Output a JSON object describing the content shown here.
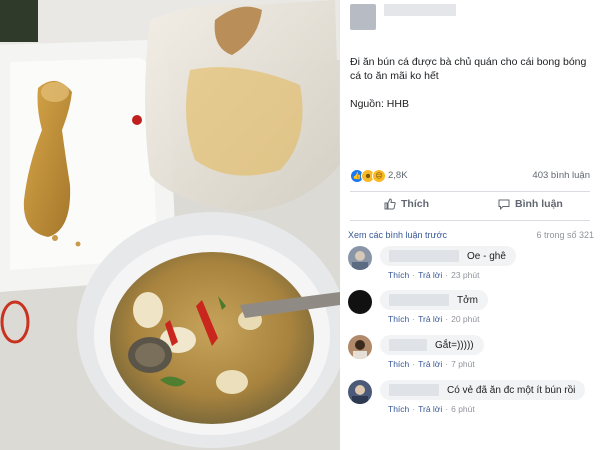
{
  "post": {
    "text": "Đi ăn bún cá được bà chủ quán cho cái bong bóng cá to ăn mãi ko hết",
    "source": "Nguồn: HHB"
  },
  "reactions": {
    "count": "2,8K",
    "comments_count": "403 bình luận",
    "icons": [
      "like-icon",
      "haha-icon",
      "sad-icon"
    ]
  },
  "actions": {
    "like_label": "Thích",
    "comment_label": "Bình luận"
  },
  "comments_header": {
    "more_label": "Xem các bình luận trước",
    "count_label": "6 trong số 321"
  },
  "comments": [
    {
      "text": "Oe - ghê",
      "like": "Thích",
      "reply": "Trả lời",
      "time": "23 phút"
    },
    {
      "text": "Tởm",
      "like": "Thích",
      "reply": "Trả lời",
      "time": "20 phút"
    },
    {
      "text": "Gắt=)))))",
      "like": "Thích",
      "reply": "Trả lời",
      "time": "7 phút"
    },
    {
      "text": "Có vẻ đã ăn đc một ít bún rồi",
      "like": "Thích",
      "reply": "Trả lời",
      "time": "6 phút"
    }
  ],
  "colors": {
    "link": "#385898",
    "muted": "#90949c",
    "bubble": "#f2f3f5",
    "like_blue": "#1877f2"
  }
}
